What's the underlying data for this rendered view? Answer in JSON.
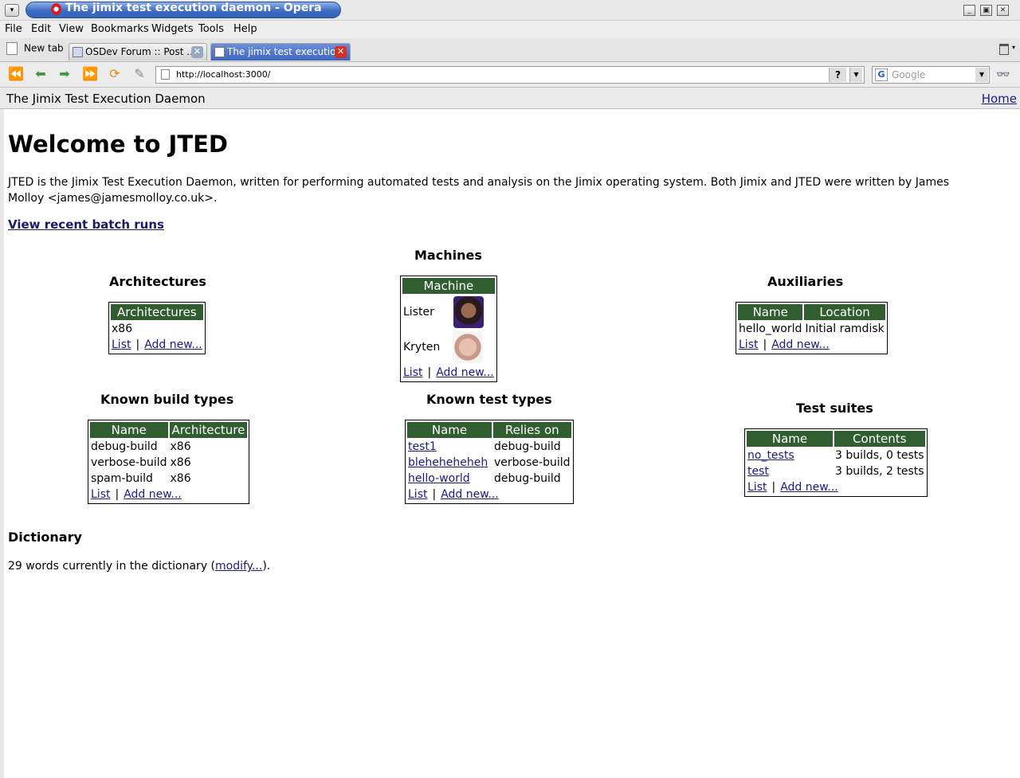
{
  "window": {
    "title": "The jimix test execution daemon - Opera"
  },
  "menu": [
    "File",
    "Edit",
    "View",
    "Bookmarks",
    "Widgets",
    "Tools",
    "Help"
  ],
  "tabs": {
    "new_tab": "New tab",
    "items": [
      {
        "label": "OSDev Forum :: Post ..."
      },
      {
        "label": "The jimix test executio..."
      }
    ]
  },
  "address": {
    "url": "http://localhost:3000/",
    "help": "?",
    "search_placeholder": "Google"
  },
  "header": {
    "site_title": "The Jimix Test Execution Daemon",
    "home": "Home"
  },
  "page": {
    "heading": "Welcome to JTED",
    "intro": "JTED is the Jimix Test Execution Daemon, written for performing automated tests and analysis on the Jimix operating system. Both Jimix and JTED were written by James Molloy <james@jamesmolloy.co.uk>.",
    "recent_link": "View recent batch runs"
  },
  "architectures": {
    "title": "Architectures",
    "header": "Architectures",
    "rows": [
      "x86"
    ],
    "list": "List",
    "add": "Add new..."
  },
  "machines": {
    "title": "Machines",
    "header": "Machine",
    "rows": [
      {
        "name": "Lister"
      },
      {
        "name": "Kryten"
      }
    ],
    "list": "List",
    "add": "Add new..."
  },
  "auxiliaries": {
    "title": "Auxiliaries",
    "headers": [
      "Name",
      "Location"
    ],
    "rows": [
      {
        "name": "hello_world",
        "location": "Initial ramdisk"
      }
    ],
    "list": "List",
    "add": "Add new..."
  },
  "build_types": {
    "title": "Known build types",
    "headers": [
      "Name",
      "Architecture"
    ],
    "rows": [
      {
        "name": "debug-build",
        "arch": "x86"
      },
      {
        "name": "verbose-build",
        "arch": "x86"
      },
      {
        "name": "spam-build",
        "arch": "x86"
      }
    ],
    "list": "List",
    "add": "Add new..."
  },
  "test_types": {
    "title": "Known test types",
    "headers": [
      "Name",
      "Relies on"
    ],
    "rows": [
      {
        "name": "test1",
        "relies": "debug-build"
      },
      {
        "name": "blehehehehe​h",
        "relies": "verbose-build"
      },
      {
        "name": "hello-world",
        "relies": "debug-build"
      }
    ],
    "list": "List",
    "add": "Add new..."
  },
  "test_suites": {
    "title": "Test suites",
    "headers": [
      "Name",
      "Contents"
    ],
    "rows": [
      {
        "name": "no_tests",
        "contents": "3 builds, 0 tests"
      },
      {
        "name": "test",
        "contents": "3 builds, 2 tests"
      }
    ],
    "list": "List",
    "add": "Add new..."
  },
  "dictionary": {
    "title": "Dictionary",
    "prefix": "29 words currently in the dictionary (",
    "link": "modify...",
    "suffix": ")."
  },
  "colors": {
    "table_header": "#305e30",
    "title_bar": "#3e6cc4",
    "link": "#1a1a8a"
  }
}
